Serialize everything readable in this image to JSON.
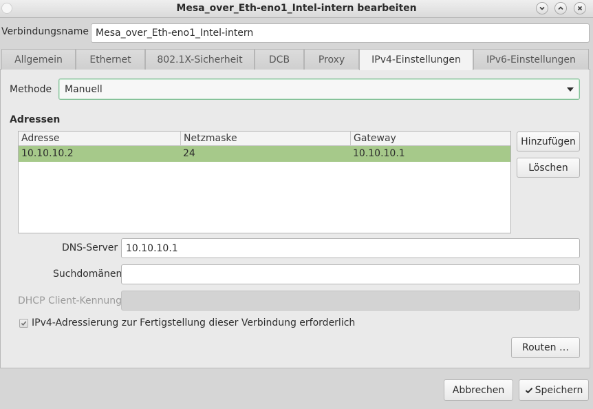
{
  "window": {
    "title": "Mesa_over_Eth-eno1_Intel-intern bearbeiten"
  },
  "connection": {
    "name_label": "Verbindungsname",
    "name_value": "Mesa_over_Eth-eno1_Intel-intern"
  },
  "tabs": [
    {
      "label": "Allgemein",
      "active": false
    },
    {
      "label": "Ethernet",
      "active": false
    },
    {
      "label": "802.1X-Sicherheit",
      "active": false
    },
    {
      "label": "DCB",
      "active": false
    },
    {
      "label": "Proxy",
      "active": false
    },
    {
      "label": "IPv4-Einstellungen",
      "active": true
    },
    {
      "label": "IPv6-Einstellungen",
      "active": false
    }
  ],
  "ipv4": {
    "method_label": "Methode",
    "method_value": "Manuell",
    "addresses_title": "Adressen",
    "columns": [
      "Adresse",
      "Netzmaske",
      "Gateway"
    ],
    "rows": [
      {
        "address": "10.10.10.2",
        "netmask": "24",
        "gateway": "10.10.10.1",
        "selected": true
      }
    ],
    "add_button": "Hinzufügen",
    "delete_button": "Löschen",
    "dns_label": "DNS-Server",
    "dns_value": "10.10.10.1",
    "search_domains_label": "Suchdomänen",
    "search_domains_value": "",
    "dhcp_client_id_label": "DHCP Client-Kennung",
    "dhcp_client_id_value": "",
    "require_ipv4_label": "IPv4-Adressierung zur Fertigstellung dieser Verbindung erforderlich",
    "require_ipv4_checked": true,
    "routes_button": "Routen …"
  },
  "footer": {
    "cancel_button": "Abbrechen",
    "save_button": "Speichern"
  },
  "colors": {
    "selected_row": "#a6c98a",
    "focus_border": "#86c19a"
  }
}
